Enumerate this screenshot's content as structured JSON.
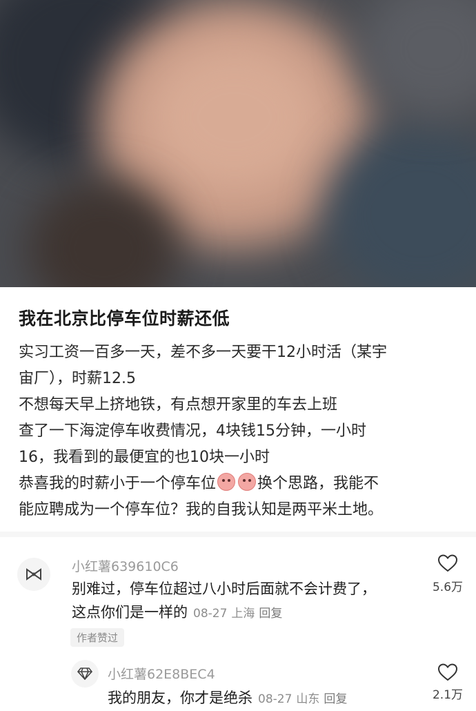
{
  "post": {
    "title": "我在北京比停车位时薪还低",
    "lines": [
      "实习工资一百多一天，差不多一天要干12小时活（某宇",
      "宙厂），时薪12.5",
      "不想每天早上挤地铁，有点想开家里的车去上班",
      "查了一下海淀停车收费情况，4块钱15分钟，一小时",
      "16，我看到的最便宜的也10块一小时"
    ],
    "line6_before": "恭喜我的时薪小于一个停车位",
    "line6_after": "换个思路，我能不",
    "line7": "能应聘成为一个停车位？我的自我认知是两平米土地。"
  },
  "comments": [
    {
      "username": "小红薯639610C6",
      "text_line1": "别难过，停车位超过八小时后面就不会计费了，",
      "text_line2": "这点你们是一样的",
      "date": "08-27",
      "location": "上海",
      "reply_label": "回复",
      "likes": "5.6万",
      "author_liked": "作者赞过"
    },
    {
      "username": "小红薯62E8BEC4",
      "text": "我的朋友，你才是绝杀",
      "date": "08-27",
      "location": "山东",
      "reply_label": "回复",
      "likes": "2.1万"
    }
  ],
  "colors": {
    "text": "#222222",
    "muted": "#9a9a9a",
    "photo_bg": "#4a4c51"
  }
}
